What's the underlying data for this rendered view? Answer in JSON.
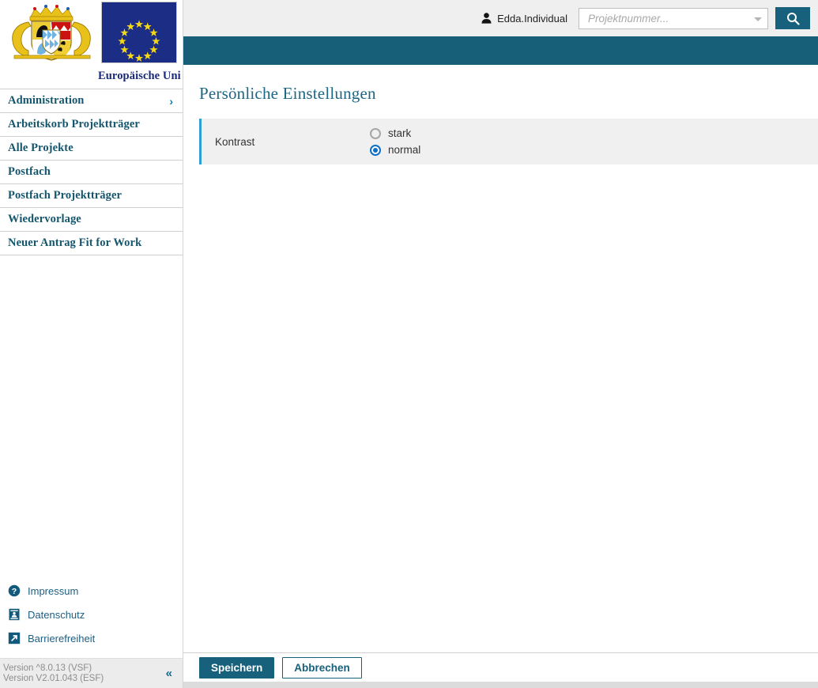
{
  "header": {
    "user_name": "Edda.Individual",
    "user_icon": "person-icon",
    "search_placeholder": "Projektnummer...",
    "search_value": "",
    "search_button_icon": "search-icon",
    "dropdown_icon": "chevron-down-icon"
  },
  "branding": {
    "crest_alt": "bavaria-coat-of-arms",
    "eu_flag_alt": "european-union-flag",
    "eu_label": "Europäische Uni"
  },
  "sidebar": {
    "items": [
      {
        "label": "Administration",
        "has_chevron": true,
        "chevron": "›"
      },
      {
        "label": "Arbeitskorb Projektträger",
        "has_chevron": false
      },
      {
        "label": "Alle Projekte",
        "has_chevron": false
      },
      {
        "label": "Postfach",
        "has_chevron": false
      },
      {
        "label": "Postfach Projektträger",
        "has_chevron": false
      },
      {
        "label": "Wiedervorlage",
        "has_chevron": false
      },
      {
        "label": "Neuer Antrag Fit for Work",
        "has_chevron": false
      }
    ],
    "footer_links": [
      {
        "label": "Impressum",
        "icon": "question-circle-icon"
      },
      {
        "label": "Datenschutz",
        "icon": "privacy-document-icon"
      },
      {
        "label": "Barrierefreiheit",
        "icon": "accessibility-arrow-icon"
      }
    ],
    "version_line_1": "Version ^8.0.13 (VSF)",
    "version_line_2": "Version V2.01.043 (ESF)",
    "collapse_icon": "«"
  },
  "main": {
    "page_title": "Persönliche Einstellungen",
    "form": {
      "field_label": "Kontrast",
      "options": [
        {
          "label": "stark",
          "selected": false
        },
        {
          "label": "normal",
          "selected": true
        }
      ]
    },
    "actions": {
      "save_label": "Speichern",
      "cancel_label": "Abbrechen"
    }
  },
  "colors": {
    "teal": "#17617c",
    "teal_bar": "#175f79",
    "nav_text": "#14566d",
    "accent_border": "#2f9fd0",
    "radio_selected": "#0d6ec6",
    "row_background": "#f0f0f0",
    "topbar_background": "#efefef"
  }
}
